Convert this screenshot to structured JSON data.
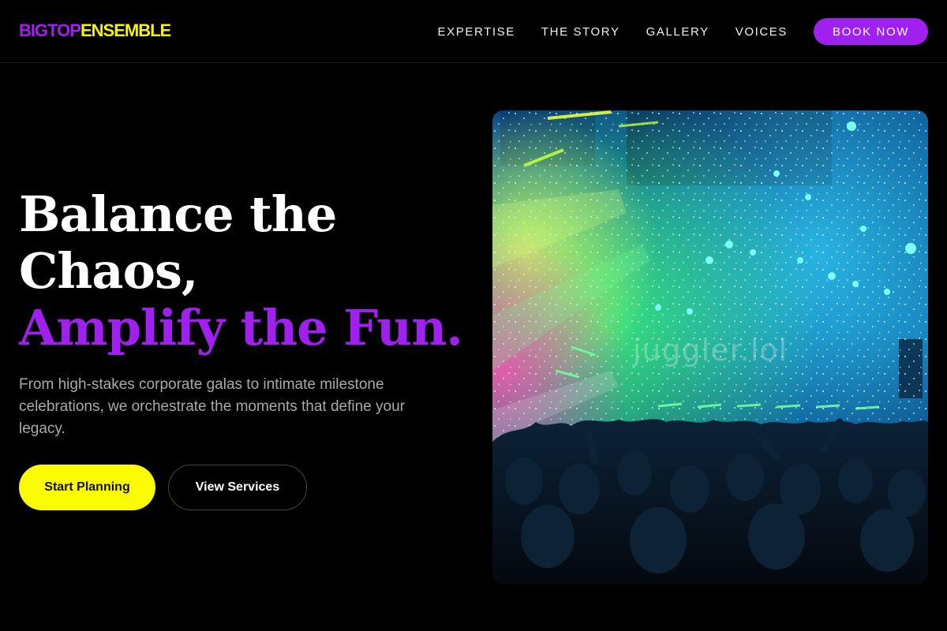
{
  "brand": {
    "part1": "BIGTOP",
    "part2": "ENSEMBLE"
  },
  "nav": {
    "links": [
      "EXPERTISE",
      "THE STORY",
      "GALLERY",
      "VOICES"
    ],
    "cta": "BOOK NOW"
  },
  "hero": {
    "title_line1": "Balance the",
    "title_line2": "Chaos,",
    "title_accent": "Amplify the Fun.",
    "subtitle": "From high-stakes corporate galas to intimate milestone celebrations, we orchestrate the moments that define your legacy.",
    "primary_button": "Start Planning",
    "secondary_button": "View Services"
  },
  "image": {
    "watermark": "juggler.lol",
    "subject": "concert-crowd-confetti"
  },
  "colors": {
    "accent": "#a020f0",
    "yellow": "#fbfb00",
    "background": "#000000"
  }
}
